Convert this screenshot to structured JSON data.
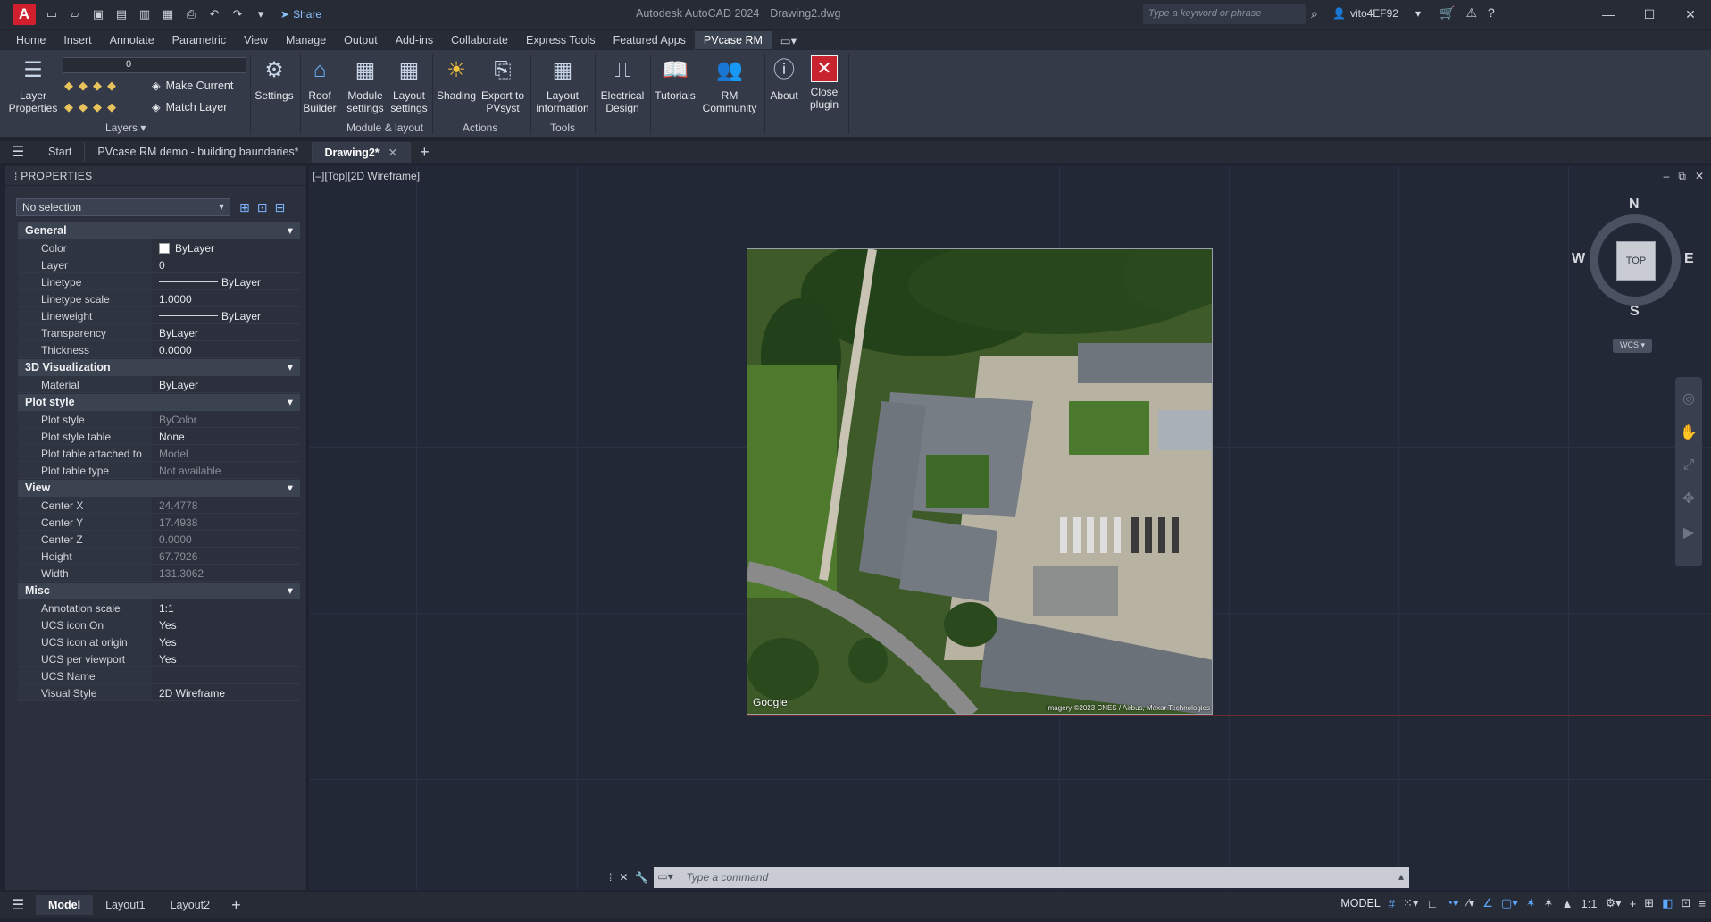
{
  "app": {
    "title": "Autodesk AutoCAD 2024",
    "filename": "Drawing2.dwg",
    "logo": "A",
    "share_label": "Share",
    "search_placeholder": "Type a keyword or phrase",
    "user": "vito4EF92"
  },
  "ribbon_tabs": [
    "Home",
    "Insert",
    "Annotate",
    "Parametric",
    "View",
    "Manage",
    "Output",
    "Add-ins",
    "Collaborate",
    "Express Tools",
    "Featured Apps",
    "PVcase RM"
  ],
  "ribbon": {
    "layer_properties": "Layer Properties",
    "layer_value": "0",
    "make_current": "Make Current",
    "match_layer": "Match Layer",
    "layers_panel": "Layers",
    "settings": "Settings",
    "roof_builder": "Roof Builder",
    "module_settings": "Module settings",
    "layout_settings": "Layout settings",
    "module_layout_panel": "Module & layout",
    "shading": "Shading",
    "export_pvsyst": "Export to PVsyst",
    "actions_panel": "Actions",
    "layout_information": "Layout information",
    "tools_panel": "Tools",
    "electrical_design": "Electrical Design",
    "tutorials": "Tutorials",
    "rm_community": "RM Community",
    "about": "About",
    "close_plugin": "Close plugin"
  },
  "doc_tabs": {
    "start": "Start",
    "demo": "PVcase RM demo - building baundaries*",
    "drawing": "Drawing2*"
  },
  "properties": {
    "title": "PROPERTIES",
    "selection": "No selection",
    "general": {
      "label": "General",
      "color": {
        "k": "Color",
        "v": "ByLayer"
      },
      "layer": {
        "k": "Layer",
        "v": "0"
      },
      "linetype": {
        "k": "Linetype",
        "v": "ByLayer"
      },
      "linetype_scale": {
        "k": "Linetype scale",
        "v": "1.0000"
      },
      "lineweight": {
        "k": "Lineweight",
        "v": "ByLayer"
      },
      "transparency": {
        "k": "Transparency",
        "v": "ByLayer"
      },
      "thickness": {
        "k": "Thickness",
        "v": "0.0000"
      }
    },
    "viz3d": {
      "label": "3D Visualization",
      "material": {
        "k": "Material",
        "v": "ByLayer"
      }
    },
    "plot": {
      "label": "Plot style",
      "plot_style": {
        "k": "Plot style",
        "v": "ByColor"
      },
      "plot_style_table": {
        "k": "Plot style table",
        "v": "None"
      },
      "plot_table_attached": {
        "k": "Plot table attached to",
        "v": "Model"
      },
      "plot_table_type": {
        "k": "Plot table type",
        "v": "Not available"
      }
    },
    "view": {
      "label": "View",
      "center_x": {
        "k": "Center X",
        "v": "24.4778"
      },
      "center_y": {
        "k": "Center Y",
        "v": "17.4938"
      },
      "center_z": {
        "k": "Center Z",
        "v": "0.0000"
      },
      "height": {
        "k": "Height",
        "v": "67.7926"
      },
      "width": {
        "k": "Width",
        "v": "131.3062"
      }
    },
    "misc": {
      "label": "Misc",
      "annotation_scale": {
        "k": "Annotation scale",
        "v": "1:1"
      },
      "ucs_icon_on": {
        "k": "UCS icon On",
        "v": "Yes"
      },
      "ucs_icon_origin": {
        "k": "UCS icon at origin",
        "v": "Yes"
      },
      "ucs_per_viewport": {
        "k": "UCS per viewport",
        "v": "Yes"
      },
      "ucs_name": {
        "k": "UCS Name",
        "v": ""
      },
      "visual_style": {
        "k": "Visual Style",
        "v": "2D Wireframe"
      }
    }
  },
  "viewport": {
    "label": "[–][Top][2D Wireframe]",
    "credit_google": "Google",
    "credit_imagery": "Imagery ©2023 CNES / Airbus, Maxar Technologies"
  },
  "viewcube": {
    "n": "N",
    "s": "S",
    "e": "E",
    "w": "W",
    "top": "TOP",
    "wcs": "WCS"
  },
  "command": {
    "placeholder": "Type a command"
  },
  "status": {
    "model_tab": "Model",
    "layout1": "Layout1",
    "layout2": "Layout2",
    "model_label": "MODEL",
    "scale": "1:1"
  }
}
